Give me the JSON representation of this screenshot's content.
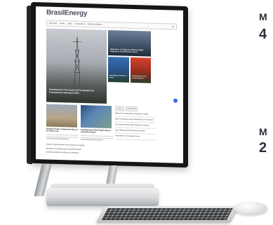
{
  "side_text": {
    "a": "M",
    "b": "4",
    "c": "M",
    "d": "2"
  },
  "site": {
    "logo": "BrasilEnergy",
    "nav": [
      "Oil & Gas",
      "Power",
      "Grids",
      "Latest News",
      "Premium Editions"
    ],
    "search_icon": "search-icon"
  },
  "hero": {
    "main_caption": "Distribution In The Center Of The Network Of Transmission Starting In 2024",
    "r1_caption": "Shell Aims To Begin Its Offshore Wind Projects In The Next Five Years",
    "r2_caption": "New Battery Projects in Brazil",
    "r3_caption": "Transmission Lines Auction Results"
  },
  "cards": [
    {
      "title": "Brazilian Power Trading Hits Record As Prices Fall"
    },
    {
      "title": "Floating Solar Plant Project Moves Forward In Brazil"
    }
  ],
  "sidebar": {
    "tabs": [
      "Latest",
      "Most Read"
    ],
    "items": [
      "Offshore Wind Regulation Advances In Senate",
      "New Gas Pipeline Auction Scheduled For Next Month",
      "Grid Operator Sees Higher Demand In Summer",
      "Hydro Reservoirs Reach Seasonal Levels",
      "Investment In Transmission Grows"
    ]
  },
  "list": [
    "Energy Transition Agenda Gains Support In Congress",
    "Distribution Companies Report Quarterly Results",
    "Biofuels Mandate Under Review By Regulator"
  ],
  "colors": {
    "accent": "#2f6fe0",
    "brand_text": "#4a4f5c"
  }
}
